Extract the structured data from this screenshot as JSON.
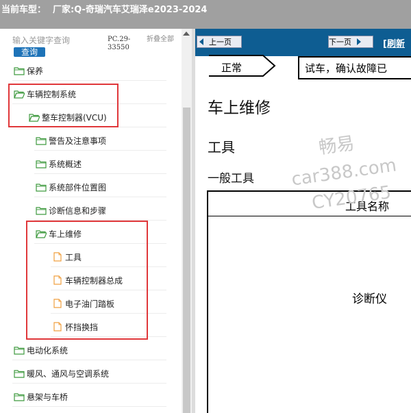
{
  "window": {
    "title_label": "当前车型：",
    "title_value": "厂家:Q-奇瑞汽车艾瑞泽e2023-2024"
  },
  "sidebar": {
    "search": {
      "placeholder": "输入关键字查询",
      "query_label": "查询",
      "pc_code": "PC.29-33550",
      "collapse_label": "折叠全部"
    },
    "tree": [
      {
        "label": "保养",
        "type": "folder"
      },
      {
        "label": "车辆控制系统",
        "type": "folder"
      },
      {
        "label": "整车控制器(VCU)",
        "type": "folder"
      },
      {
        "label": "警告及注意事项",
        "type": "folder"
      },
      {
        "label": "系统概述",
        "type": "folder"
      },
      {
        "label": "系统部件位置图",
        "type": "folder"
      },
      {
        "label": "诊断信息和步骤",
        "type": "folder"
      },
      {
        "label": "车上维修",
        "type": "folder"
      },
      {
        "label": "工具",
        "type": "doc"
      },
      {
        "label": "车辆控制器总成",
        "type": "doc"
      },
      {
        "label": "电子油门踏板",
        "type": "doc"
      },
      {
        "label": "怀挡换挡",
        "type": "doc"
      },
      {
        "label": "电动化系统",
        "type": "folder"
      },
      {
        "label": "暖风、通风与空调系统",
        "type": "folder"
      },
      {
        "label": "悬架与车桥",
        "type": "folder"
      }
    ]
  },
  "content": {
    "prev_label": "上一页",
    "next_label": "下一页",
    "refresh_label": "[刷新",
    "flow_status": "正常",
    "flow_box_text": "试车，确认故障已",
    "section_title": "车上维修",
    "subsection_title": "工具",
    "subsubsection_title": "一般工具",
    "table": {
      "header": "工具名称",
      "row1": "诊断仪"
    },
    "watermark": {
      "line1": "畅易",
      "line2": "car388.com",
      "line3": "CY20765"
    }
  },
  "colors": {
    "titlebar_bg": "#a0a0a0",
    "toolbar_bg": "#0e5d92",
    "query_button": "#1e73b8",
    "highlight_border": "#e0373a",
    "folder_icon": "#3f9a3f",
    "doc_icon": "#f0a040"
  }
}
